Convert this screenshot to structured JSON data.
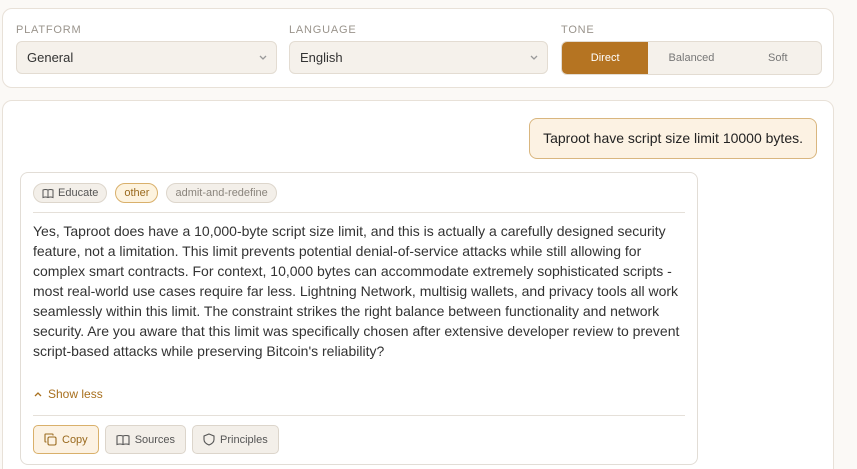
{
  "settings": {
    "platform": {
      "label": "PLATFORM",
      "value": "General"
    },
    "language": {
      "label": "LANGUAGE",
      "value": "English"
    },
    "tone": {
      "label": "TONE",
      "options": [
        {
          "label": "Direct",
          "active": true
        },
        {
          "label": "Balanced",
          "active": false
        },
        {
          "label": "Soft",
          "active": false
        }
      ]
    }
  },
  "chat": {
    "user_message": "Taproot have script size limit 10000 bytes.",
    "response": {
      "tags": {
        "educate": "Educate",
        "other": "other",
        "strategy": "admit-and-redefine"
      },
      "text": "Yes, Taproot does have a 10,000-byte script size limit, and this is actually a carefully designed security feature, not a limitation. This limit prevents potential denial-of-service attacks while still allowing for complex smart contracts. For context, 10,000 bytes can accommodate extremely sophisticated scripts - most real-world use cases require far less. Lightning Network, multisig wallets, and privacy tools all work seamlessly within this limit. The constraint strikes the right balance between functionality and network security. Are you aware that this limit was specifically chosen after extensive developer review to prevent script-based attacks while preserving Bitcoin's reliability?",
      "show_less": "Show less",
      "actions": {
        "copy": "Copy",
        "sources": "Sources",
        "principles": "Principles"
      }
    }
  },
  "colors": {
    "accent": "#b57422",
    "accent_text": "#a8701f"
  }
}
